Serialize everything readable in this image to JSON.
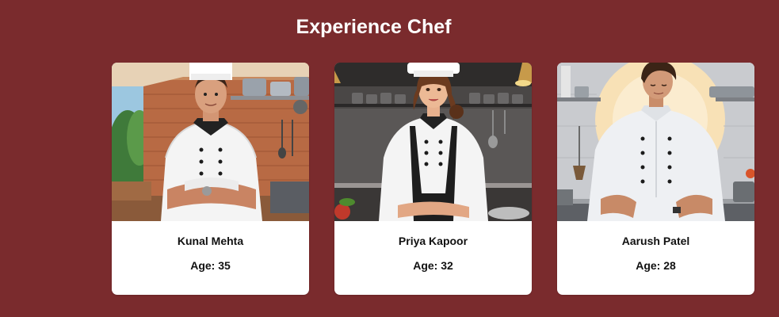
{
  "page": {
    "title": "Experience Chef",
    "background_color": "#7a2b2d"
  },
  "chefs": [
    {
      "name": "Kunal Mehta",
      "age": "Age: 35",
      "image": "chef-kunal-mehta-illustration"
    },
    {
      "name": "Priya Kapoor",
      "age": "Age: 32",
      "image": "chef-priya-kapoor-illustration"
    },
    {
      "name": "Aarush Patel",
      "age": "Age: 28",
      "image": "chef-aarush-patel-illustration"
    }
  ]
}
